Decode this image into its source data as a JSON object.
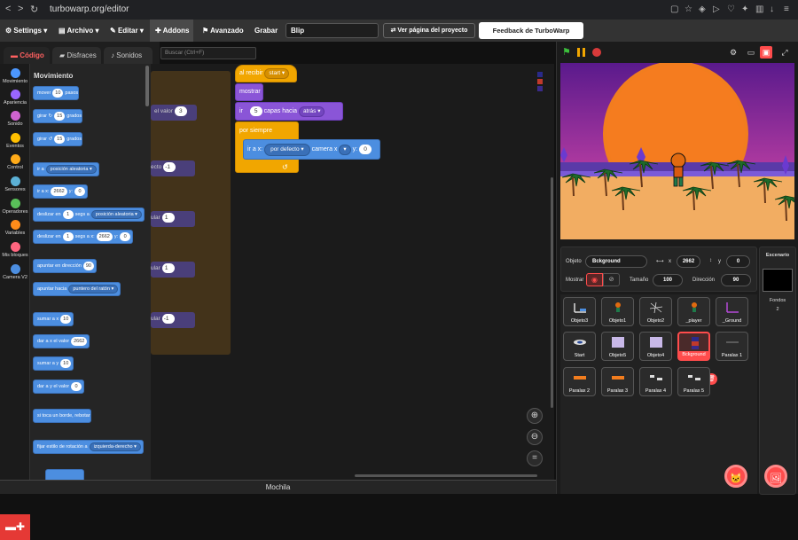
{
  "browser": {
    "url": "turbowarp.org/editor"
  },
  "menubar": {
    "settings": "Settings",
    "file": "Archivo",
    "edit": "Editar",
    "addons": "Addons",
    "advanced": "Avanzado",
    "record": "Grabar",
    "project_title": "Blip",
    "see_project_page": "Ver página del proyecto",
    "feedback": "Feedback de TurboWarp"
  },
  "tabs": {
    "code": "Código",
    "costumes": "Disfraces",
    "sounds": "Sonidos"
  },
  "categories": [
    {
      "label": "Movimiento",
      "color": "#4c97ff"
    },
    {
      "label": "Apariencia",
      "color": "#9966ff"
    },
    {
      "label": "Sonido",
      "color": "#cf63cf"
    },
    {
      "label": "Eventos",
      "color": "#ffbf00"
    },
    {
      "label": "Control",
      "color": "#ffab19"
    },
    {
      "label": "Sensores",
      "color": "#5cb1d6"
    },
    {
      "label": "Operadores",
      "color": "#59c059"
    },
    {
      "label": "Variables",
      "color": "#ff8c1a"
    },
    {
      "label": "Mis bloques",
      "color": "#ff6680"
    },
    {
      "label": "Camera V2",
      "color": "#4c8ee0"
    }
  ],
  "palette": {
    "title": "Movimiento",
    "blocks": {
      "move_a": "mover",
      "move_v": "10",
      "move_b": "pasos",
      "turn_r_a": "girar",
      "turn_r_v": "15",
      "turn_r_b": "grados",
      "turn_l_a": "girar",
      "turn_l_v": "15",
      "turn_l_b": "grados",
      "goto_a": "ir a",
      "goto_d": "posición aleatoria",
      "gotoxy_a": "ir a x:",
      "gotoxy_x": "2662",
      "gotoxy_b": "y:",
      "gotoxy_y": "0",
      "glide_a": "deslizar en",
      "glide_v": "1",
      "glide_b": "segs a",
      "glide_d": "posición aleatoria",
      "glidexy_a": "deslizar en",
      "glidexy_v": "1",
      "glidexy_b": "segs a x:",
      "glidexy_x": "2662",
      "glidexy_c": "y:",
      "glidexy_y": "0",
      "point_a": "apuntar en dirección",
      "point_v": "90",
      "pointto_a": "apuntar hacia",
      "pointto_d": "puntero del ratón",
      "changex_a": "sumar a x",
      "changex_v": "10",
      "setx_a": "dar a x el valor",
      "setx_v": "2662",
      "changey_a": "sumar a y",
      "changey_v": "10",
      "sety_a": "dar a y el valor",
      "sety_v": "0",
      "bounce": "si toca un borde, rebotar",
      "rotstyle_a": "fijar estilo de rotación a",
      "rotstyle_d": "izquierda-derecho"
    }
  },
  "workspace": {
    "search_placeholder": "Buscar (Ctrl+F)",
    "ghost_labels": {
      "g1": "el valor",
      "g1v": "3",
      "g2": "ecto",
      "g2v": "-1",
      "g3": "ular",
      "g3v": "1",
      "g4": "ular",
      "g4v": "1",
      "g5": "ular",
      "g5v": "-1"
    },
    "script": {
      "hat_a": "al recibir",
      "hat_d": "start",
      "show": "mostrar",
      "layer_a": "ir",
      "layer_v": "5",
      "layer_b": "capas hacia",
      "layer_d": "atrás",
      "forever": "por siempre",
      "goto_a": "ir a x:",
      "goto_d": "por defecto",
      "goto_b": "camera x",
      "goto_c": "y:",
      "goto_v": "0"
    }
  },
  "backpack": "Mochila",
  "sprite_info": {
    "object_label": "Objeto",
    "name": "Bckground",
    "x_label": "x",
    "x": "2662",
    "y_label": "y",
    "y": "0",
    "show_label": "Mostrar",
    "size_label": "Tamaño",
    "size": "100",
    "direction_label": "Dirección",
    "direction": "90"
  },
  "sprites": [
    "Objeto3",
    "Objeto1",
    "Objeto2",
    "_player",
    "_Ground",
    "Start",
    "Objeto5",
    "Objeto4",
    "Bckground",
    "Paralax 1",
    "Paralax 2",
    "Paralax 3",
    "Paralax 4",
    "Paralax 5"
  ],
  "selected_sprite": "Bckground",
  "scene": {
    "title": "Escenario",
    "backdrops_label": "Fondos",
    "backdrops_count": "2"
  },
  "colors": {
    "accent": "#ff4c4c",
    "motion": "#4c8ee0",
    "looks": "#8a55d7",
    "events": "#f1a600"
  }
}
